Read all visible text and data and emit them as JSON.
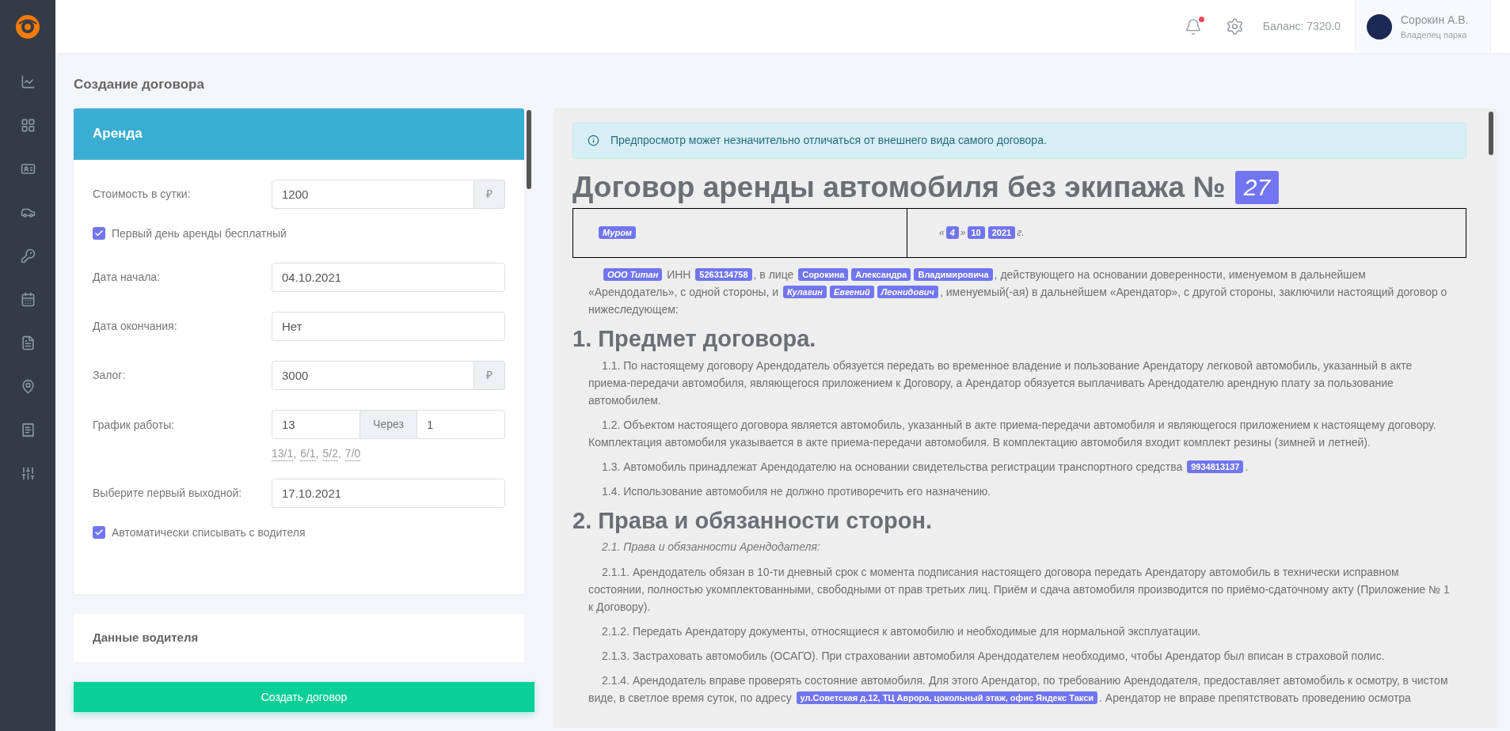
{
  "header": {
    "notifications": {
      "unread": true
    },
    "balance": "Баланс: 7320.0",
    "user": {
      "name": "Сорокин А.В.",
      "role": "Владелец парка"
    }
  },
  "page_title": "Создание договора",
  "rent_card": {
    "title": "Аренда",
    "fields": [
      {
        "kind": "input",
        "label": "Стоимость в сутки:",
        "value": "1200",
        "suffix": "₽"
      },
      {
        "kind": "checkbox",
        "label": "Первый день аренды бесплатный",
        "checked": true
      },
      {
        "kind": "input",
        "label": "Дата начала:",
        "value": "04.10.2021"
      },
      {
        "kind": "input",
        "label": "Дата окончания:",
        "value": "Нет"
      },
      {
        "kind": "input",
        "label": "Залог:",
        "value": "3000",
        "suffix": "₽"
      },
      {
        "kind": "schedule",
        "label": "График работы:",
        "work": "13",
        "middle": "Через",
        "rest": "1",
        "presets": [
          "13/1",
          "6/1",
          "5/2",
          "7/0"
        ],
        "separator": ","
      },
      {
        "kind": "input",
        "label": "Выберите первый выходной:",
        "value": "17.10.2021"
      },
      {
        "kind": "checkbox",
        "label": "Автоматически списывать с водителя",
        "checked": true
      }
    ]
  },
  "driver_section": {
    "title": "Данные водителя"
  },
  "submit_button": "Создать договор",
  "preview": {
    "notice": "Предпросмотр может незначительно отличаться от внешнего вида самого договора.",
    "title": "Договор аренды автомобиля без экипажа №",
    "number": "27",
    "city": [
      {
        "kind": "tag",
        "text": "Муром",
        "italic": true
      }
    ],
    "date": [
      {
        "kind": "mark",
        "text": "«"
      },
      {
        "kind": "tag",
        "text": "4",
        "italic": true
      },
      {
        "kind": "mark",
        "text": "»"
      },
      {
        "kind": "tag",
        "text": "10",
        "italic": false
      },
      {
        "kind": "tag",
        "text": "2021",
        "italic": false
      },
      {
        "kind": "mark",
        "text": "г."
      }
    ],
    "blocks": [
      {
        "kind": "paragraph",
        "segments": [
          {
            "kind": "tag",
            "text": "ООО Титан",
            "italic": true
          },
          {
            "kind": "text",
            "text": " ИНН "
          },
          {
            "kind": "tag",
            "text": "5263134758",
            "italic": false
          },
          {
            "kind": "text",
            "text": ", в лице "
          },
          {
            "kind": "tag",
            "text": "Сорокина",
            "italic": false
          },
          {
            "kind": "tag",
            "text": "Александра",
            "italic": false
          },
          {
            "kind": "tag",
            "text": "Владимировича",
            "italic": false
          },
          {
            "kind": "text",
            "text": ", действующего на основании доверенности, именуемом в дальнейшем «Арендодатель», с одной стороны, и "
          },
          {
            "kind": "tag",
            "text": "Кулагин",
            "italic": true
          },
          {
            "kind": "tag",
            "text": "Евгений",
            "italic": true
          },
          {
            "kind": "tag",
            "text": "Леонидович",
            "italic": true
          },
          {
            "kind": "text",
            "text": ", именуемый(-ая) в дальнейшем «Арендатор», с другой стороны, заключили настоящий договор о нижеследующем:"
          }
        ]
      },
      {
        "kind": "heading",
        "text": "1. Предмет договора."
      },
      {
        "kind": "paragraph",
        "segments": [
          {
            "kind": "text",
            "text": "1.1. По настоящему договору Арендодатель обязуется передать во временное владение и пользование Арендатору легковой автомобиль, указанный в акте приема-передачи автомобиля, являющегося приложением к Договору, а Арендатор обязуется выплачивать Арендодателю арендную плату за пользование автомобилем."
          }
        ]
      },
      {
        "kind": "paragraph",
        "segments": [
          {
            "kind": "text",
            "text": "1.2. Объектом настоящего договора является автомобиль, указанный в акте приема-передачи автомобиля и являющегося приложением к настоящему договору. Комплектация автомобиля указывается в акте приема-передачи автомобиля. В комплектацию автомобиля входит комплект резины (зимней и летней)."
          }
        ]
      },
      {
        "kind": "paragraph",
        "segments": [
          {
            "kind": "text",
            "text": "1.3. Автомобиль принадлежат Арендодателю на основании свидетельства регистрации транспортного средства "
          },
          {
            "kind": "tag",
            "text": "9934813137",
            "italic": false
          },
          {
            "kind": "text",
            "text": "."
          }
        ]
      },
      {
        "kind": "paragraph",
        "segments": [
          {
            "kind": "text",
            "text": "1.4. Использование автомобиля не должно противоречить его назначению."
          }
        ]
      },
      {
        "kind": "heading",
        "text": "2. Права и обязанности сторон."
      },
      {
        "kind": "subheading",
        "text": "2.1. Права и обязанности Арендодателя:"
      },
      {
        "kind": "paragraph",
        "segments": [
          {
            "kind": "text",
            "text": "2.1.1. Арендодатель обязан в 10-ти дневный срок с момента подписания настоящего договора передать Арендатору автомобиль в технически исправном состоянии, полностью укомплектованными, свободными от прав третьих лиц. Приём и сдача автомобиля производится по приёмо-сдаточному акту (Приложение № 1 к Договору)."
          }
        ]
      },
      {
        "kind": "paragraph",
        "segments": [
          {
            "kind": "text",
            "text": "2.1.2. Передать Арендатору документы, относящиеся к автомобилю и необходимые для нормальной эксплуатации."
          }
        ]
      },
      {
        "kind": "paragraph",
        "segments": [
          {
            "kind": "text",
            "text": "2.1.3. Застраховать автомобиль (ОСАГО). При страховании автомобиля Арендодателем необходимо, чтобы Арендатор был вписан в страховой полис."
          }
        ]
      },
      {
        "kind": "paragraph",
        "segments": [
          {
            "kind": "text",
            "text": "2.1.4. Арендодатель вправе проверять состояние автомобиля. Для этого Арендатор, по требованию Арендодателя, предоставляет автомобиль к осмотру, в чистом виде, в светлое время суток, по адресу "
          },
          {
            "kind": "tag",
            "text": "ул.Советская д.12, ТЦ Аврора, цокольный этаж, офис Яндекс Такси",
            "italic": false
          },
          {
            "kind": "text",
            "text": ". Арендатор не вправе препятствовать проведению осмотра"
          }
        ]
      }
    ]
  }
}
